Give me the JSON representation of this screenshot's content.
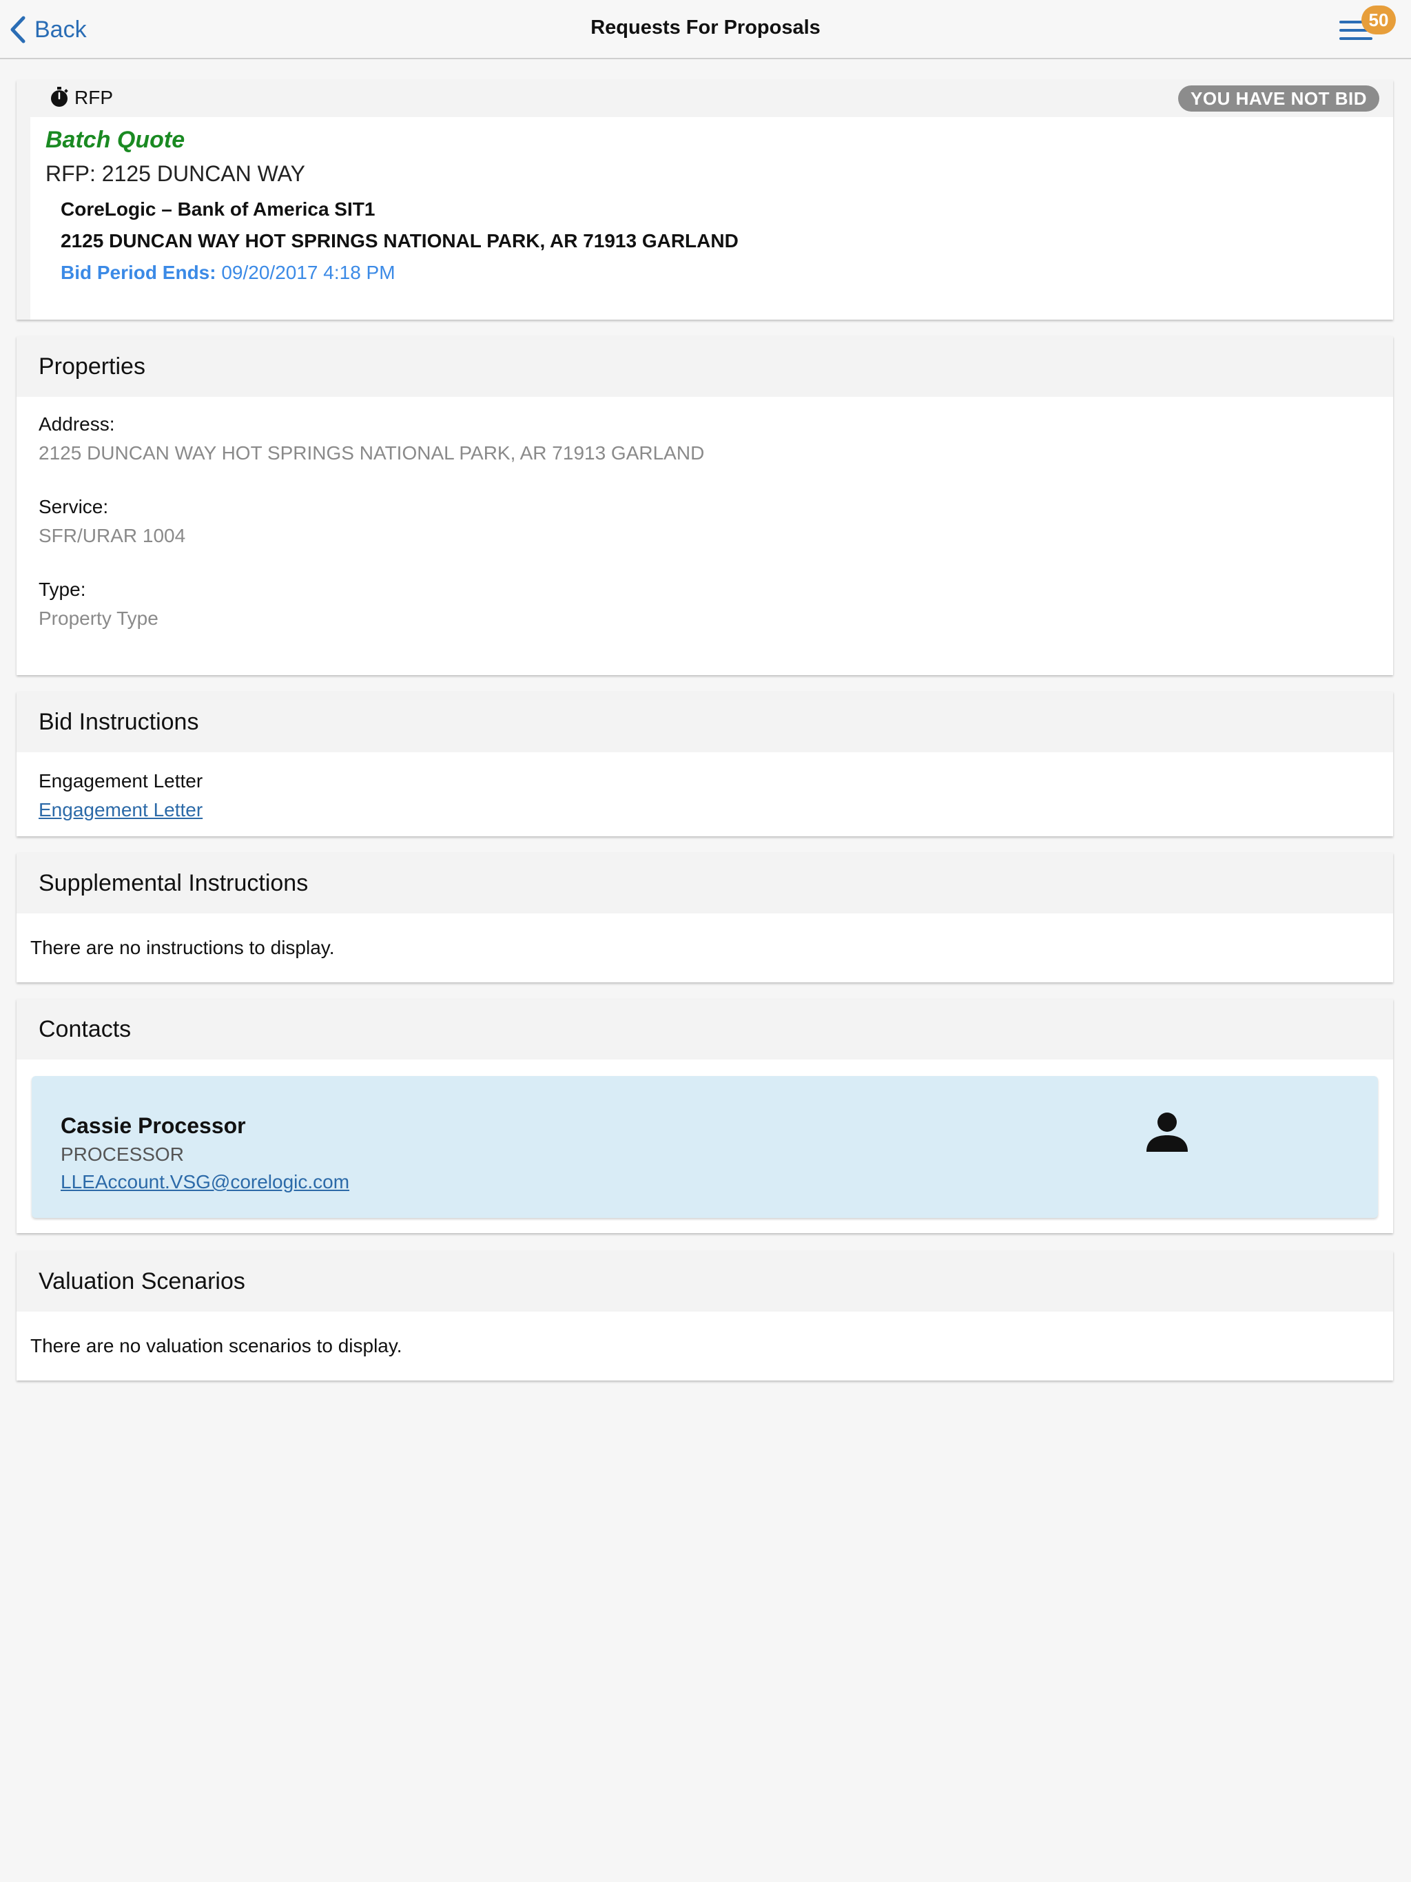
{
  "nav": {
    "back_label": "Back",
    "title": "Requests For Proposals",
    "notification_count": "50"
  },
  "rfp": {
    "type_label": "RFP",
    "status": "YOU HAVE NOT BID",
    "batch_label": "Batch Quote",
    "title": "RFP: 2125 DUNCAN WAY",
    "client": "CoreLogic – Bank of America SIT1",
    "address": "2125 DUNCAN WAY HOT SPRINGS NATIONAL PARK, AR 71913 GARLAND",
    "bid_period_label": "Bid Period Ends:",
    "bid_period_value": "09/20/2017 4:18 PM"
  },
  "properties": {
    "header": "Properties",
    "address_label": "Address:",
    "address_value": "2125 DUNCAN WAY HOT SPRINGS NATIONAL PARK, AR 71913 GARLAND",
    "service_label": "Service:",
    "service_value": "SFR/URAR 1004",
    "type_label": "Type:",
    "type_value": "Property Type"
  },
  "bid_instructions": {
    "header": "Bid Instructions",
    "document_label": "Engagement Letter",
    "document_link": "Engagement Letter"
  },
  "supplemental": {
    "header": "Supplemental Instructions",
    "empty_text": "There are no instructions to display."
  },
  "contacts": {
    "header": "Contacts",
    "items": [
      {
        "name": "Cassie Processor",
        "role": "PROCESSOR",
        "email": "LLEAccount.VSG@corelogic.com"
      }
    ]
  },
  "valuation": {
    "header": "Valuation Scenarios",
    "empty_text": "There are no valuation scenarios to display."
  },
  "colors": {
    "accent_blue": "#2a6db5",
    "batch_green": "#1a8a22",
    "bid_period_blue": "#3b8ae6",
    "badge_orange": "#e79e3a",
    "status_gray": "#8c8c8c",
    "contact_bg": "#d9ecf6"
  }
}
